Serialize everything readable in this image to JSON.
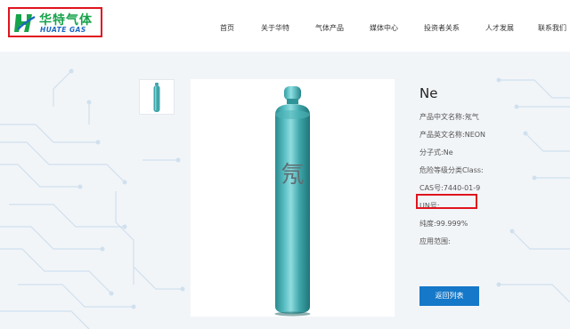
{
  "brand": {
    "name_cn": "华特气体",
    "name_en": "HUATE GAS"
  },
  "nav": {
    "items": [
      {
        "label": "首页"
      },
      {
        "label": "关于华特"
      },
      {
        "label": "气体产品"
      },
      {
        "label": "媒体中心"
      },
      {
        "label": "投资者关系"
      },
      {
        "label": "人才发展"
      },
      {
        "label": "联系我们"
      }
    ]
  },
  "product": {
    "title": "Ne",
    "cylinder_char": "氖",
    "specs": [
      {
        "label": "产品中文名称:",
        "value": "氖气"
      },
      {
        "label": "产品英文名称:",
        "value": "NEON"
      },
      {
        "label": "分子式:",
        "value": "Ne"
      },
      {
        "label": "危险等级分类Class:",
        "value": ""
      },
      {
        "label": "CAS号:",
        "value": "7440-01-9"
      },
      {
        "label": "UN号:",
        "value": ""
      },
      {
        "label": "纯度:",
        "value": "99.999%"
      },
      {
        "label": "应用范围:",
        "value": ""
      }
    ],
    "back_button": "返回列表"
  },
  "colors": {
    "accent": "#1578c8",
    "highlight": "#e0141e",
    "cylinder": "#3fa6aa",
    "circuit": "#cfe0ee"
  }
}
